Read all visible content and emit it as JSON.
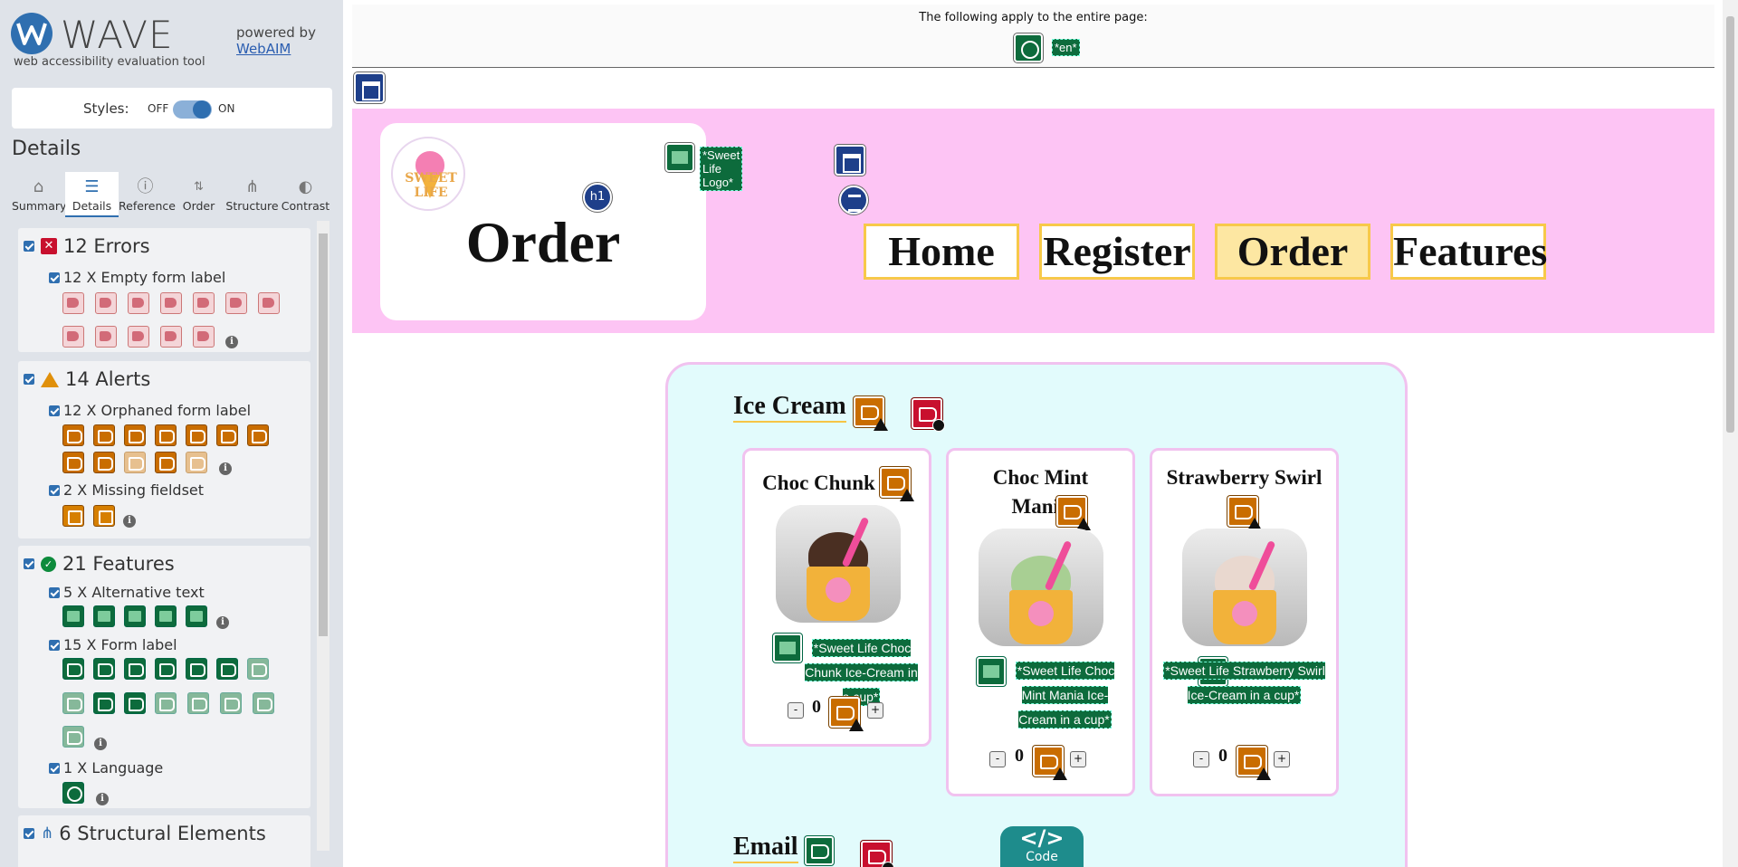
{
  "wave": {
    "logo_text": "WAVE",
    "tagline": "web accessibility evaluation tool",
    "powered_by": "powered by",
    "webaim_link": "WebAIM",
    "styles_label": "Styles:",
    "styles_off": "OFF",
    "styles_on": "ON",
    "details_heading": "Details",
    "tabs": [
      {
        "label": "Summary",
        "icon": "home-icon"
      },
      {
        "label": "Details",
        "icon": "list-icon",
        "active": true
      },
      {
        "label": "Reference",
        "icon": "info-icon"
      },
      {
        "label": "Order",
        "icon": "order-icon"
      },
      {
        "label": "Structure",
        "icon": "structure-icon"
      },
      {
        "label": "Contrast",
        "icon": "contrast-icon"
      }
    ],
    "errors": {
      "title": "12 Errors",
      "items": [
        {
          "label": "12 X Empty form label",
          "count": 12
        }
      ]
    },
    "alerts": {
      "title": "14 Alerts",
      "items": [
        {
          "label": "12 X Orphaned form label",
          "count": 12
        },
        {
          "label": "2 X Missing fieldset",
          "count": 2
        }
      ]
    },
    "features": {
      "title": "21 Features",
      "items": [
        {
          "label": "5 X Alternative text",
          "count": 5
        },
        {
          "label": "15 X Form label",
          "count": 15
        },
        {
          "label": "1 X Language",
          "count": 1
        }
      ]
    },
    "structural": {
      "title": "6 Structural Elements"
    }
  },
  "page": {
    "notice": "The following apply to the entire page:",
    "lang_label": "*en*",
    "logo_alt": "*Sweet Life Logo*",
    "logo_text": "SWEET LIFE",
    "heading": "Order",
    "h1_badge": "h1",
    "nav": [
      "Home",
      "Register",
      "Order",
      "Features"
    ],
    "current_nav": "Order",
    "ice_cream_heading": "Ice Cream",
    "email_heading": "Email",
    "code_button": "Code",
    "code_symbol": "</>",
    "products": [
      {
        "name": "Choc Chunk",
        "alt": "*Sweet Life Choc Chunk Ice-Cream in a cup*",
        "qty": "0",
        "scoop_color": "#4a2f22"
      },
      {
        "name": "Choc Mint Mania",
        "alt": "*Sweet Life Choc Mint Mania Ice-Cream in a cup*",
        "qty": "0",
        "scoop_color": "#a8cf93"
      },
      {
        "name": "Strawberry Swirl",
        "alt": "*Sweet Life Strawberry Swirl Ice-Cream in a cup*",
        "qty": "0",
        "scoop_color": "#e9d8cf"
      }
    ],
    "minus": "-",
    "plus": "+",
    "colors": {
      "header_bg": "#fdc4f4",
      "card_bg": "#e2fbfc",
      "accent": "#f7c94a",
      "wave_blue": "#2f6fb0"
    }
  }
}
